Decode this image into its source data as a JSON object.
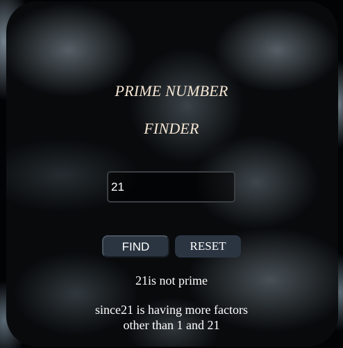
{
  "app": {
    "title_line1": "PRIME NUMBER",
    "title_line2": "FINDER"
  },
  "number_input": {
    "value": "21",
    "placeholder": ""
  },
  "buttons": {
    "find_label": "FIND",
    "reset_label": "RESET"
  },
  "result": {
    "status": "21is not prime",
    "explanation_line1": "since21 is having more factors",
    "explanation_line2": "other than 1 and 21"
  },
  "colors": {
    "title": "#f6e7d4",
    "button_bg": "#2b3542",
    "text": "#ffffff"
  }
}
